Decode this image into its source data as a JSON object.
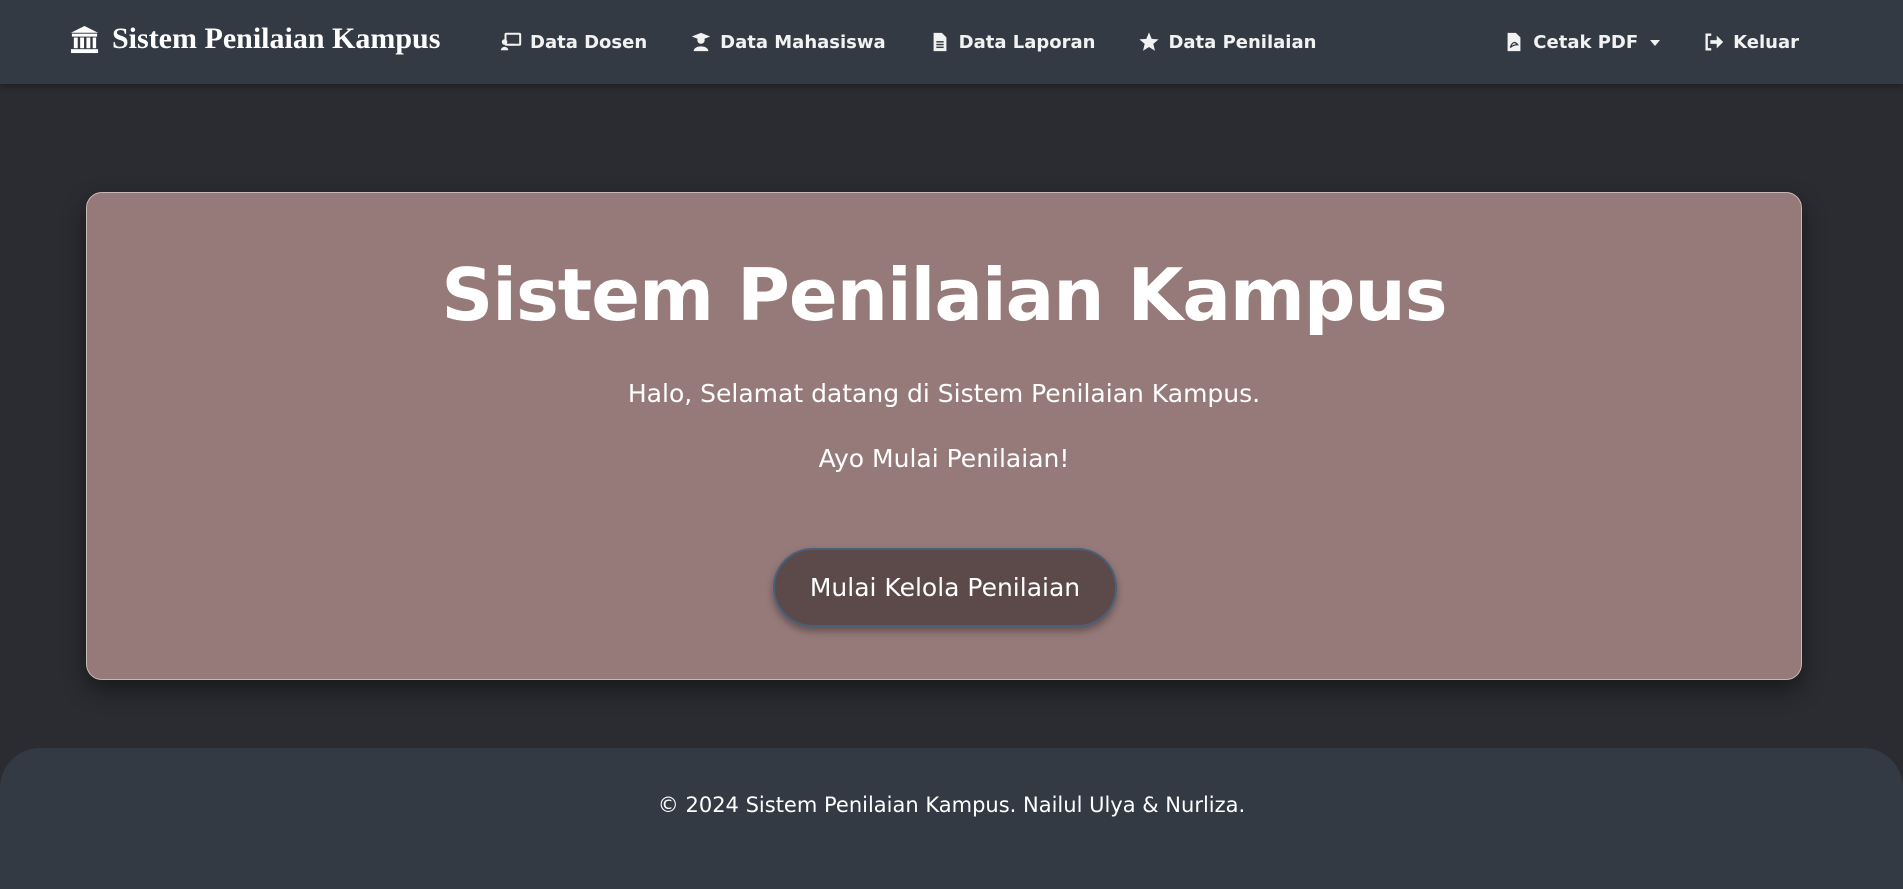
{
  "navbar": {
    "brand": "Sistem Penilaian Kampus",
    "brand_icon": "university-icon",
    "links": [
      {
        "label": "Data Dosen",
        "icon": "chalkboard-teacher-icon"
      },
      {
        "label": "Data Mahasiswa",
        "icon": "user-graduate-icon"
      },
      {
        "label": "Data Laporan",
        "icon": "file-text-icon"
      },
      {
        "label": "Data Penilaian",
        "icon": "star-icon"
      }
    ],
    "right": {
      "print_pdf": {
        "label": "Cetak PDF",
        "icon": "file-pdf-icon"
      },
      "logout": {
        "label": "Keluar",
        "icon": "sign-out-icon"
      }
    }
  },
  "hero": {
    "title": "Sistem Penilaian Kampus",
    "subtitle": "Halo, Selamat datang di Sistem Penilaian Kampus.",
    "call_to_action": "Ayo Mulai Penilaian!",
    "button_label": "Mulai Kelola Penilaian"
  },
  "footer": {
    "text": "© 2024 Sistem Penilaian Kampus. Nailul Ulya & Nurliza."
  },
  "colors": {
    "page_background": "#2a2c31",
    "navbar_background": "#343a44",
    "hero_background": "#967a7a",
    "button_background": "#5c4a4b",
    "button_border": "#47617b",
    "text": "#ffffff"
  }
}
